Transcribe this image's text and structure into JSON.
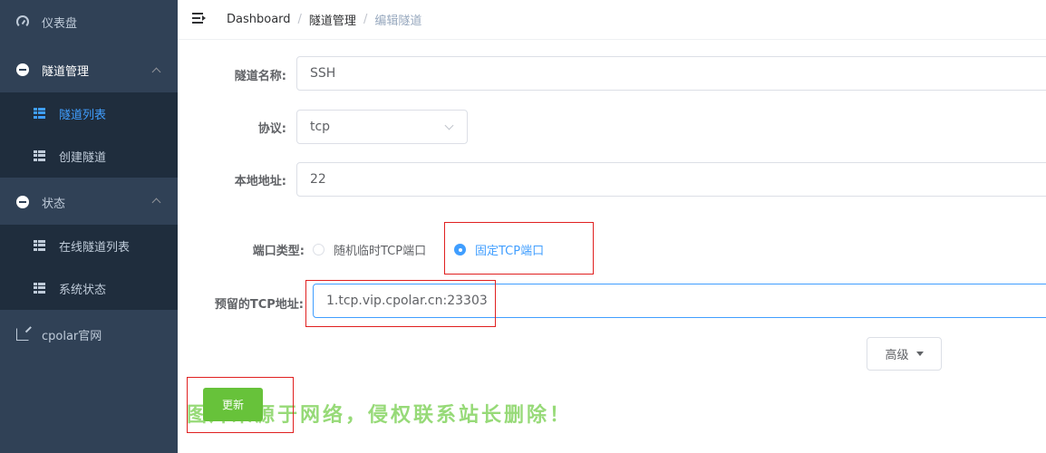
{
  "sidebar": {
    "items": [
      {
        "label": "仪表盘",
        "icon": "dashboard-gauge-icon"
      },
      {
        "label": "隧道管理",
        "icon": "tunnel-disc-icon"
      },
      {
        "label": "隧道列表",
        "icon": "grid-icon",
        "active": true
      },
      {
        "label": "创建隧道",
        "icon": "grid-icon"
      },
      {
        "label": "状态",
        "icon": "status-disc-icon"
      },
      {
        "label": "在线隧道列表",
        "icon": "grid-icon"
      },
      {
        "label": "系统状态",
        "icon": "grid-icon"
      },
      {
        "label": "cpolar官网",
        "icon": "external-link-icon"
      }
    ]
  },
  "header": {
    "breadcrumb": [
      "Dashboard",
      "隧道管理",
      "编辑隧道"
    ],
    "separator": "/"
  },
  "form": {
    "tunnel_name_label": "隧道名称:",
    "tunnel_name_value": "SSH",
    "protocol_label": "协议:",
    "protocol_value": "tcp",
    "local_address_label": "本地地址:",
    "local_address_value": "22",
    "port_type_label": "端口类型:",
    "port_type_options": [
      "随机临时TCP端口",
      "固定TCP端口"
    ],
    "port_type_selected": "固定TCP端口",
    "reserved_tcp_label": "预留的TCP地址:",
    "reserved_tcp_value": "1.tcp.vip.cpolar.cn:23303",
    "advanced_label": "高级",
    "update_label": "更新"
  },
  "watermark": "图片来源于网络，侵权联系站长删除！",
  "colors": {
    "sidebar_bg": "#304156",
    "submenu_bg": "#1f2d3d",
    "accent": "#409eff",
    "update_button": "#67c23a",
    "highlight_box": "#e02020"
  }
}
